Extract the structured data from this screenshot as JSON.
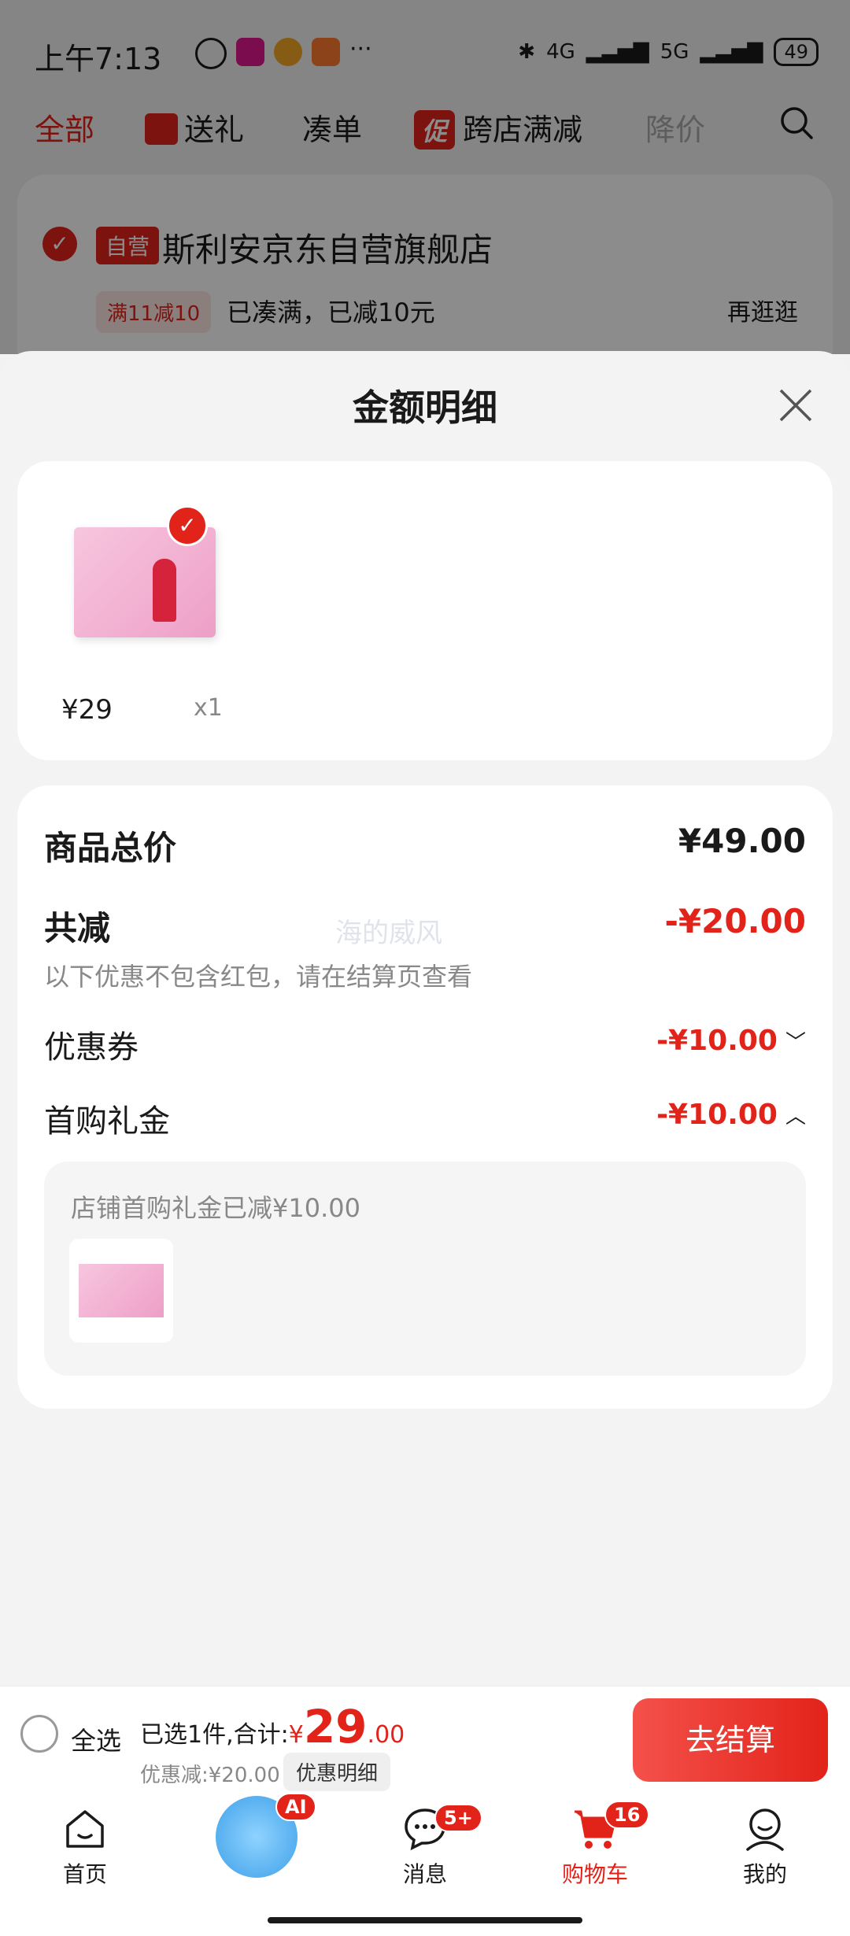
{
  "status_bar": {
    "time": "上午7:13",
    "network_left": "4G",
    "network_right": "5G",
    "battery": "49"
  },
  "top_tabs": {
    "all": "全部",
    "gift": "送礼",
    "combine": "凑单",
    "promo_badge": "促",
    "cross_store": "跨店满减",
    "price_drop": "降价"
  },
  "store": {
    "self_badge": "自营",
    "name": "斯利安京东自营旗舰店",
    "coupon_tag": "满11减10",
    "status": "已凑满，已减10元",
    "browse_more": "再逛逛"
  },
  "sheet": {
    "title": "金额明细",
    "product": {
      "price": "¥29",
      "quantity": "x1"
    },
    "summary": {
      "total_label": "商品总价",
      "total_value": "¥49.00",
      "discount_label": "共减",
      "discount_value": "-¥20.00",
      "discount_note": "以下优惠不包含红包，请在结算页查看",
      "watermark": "海的威风",
      "coupon_label": "优惠券",
      "coupon_value": "-¥10.00",
      "first_gift_label": "首购礼金",
      "first_gift_value": "-¥10.00",
      "first_gift_detail": "店铺首购礼金已减¥10.00"
    }
  },
  "bottom_bar": {
    "select_all": "全选",
    "selected_summary": "已选1件,合计:",
    "currency": "¥",
    "total_int": "29",
    "total_dec": ".00",
    "discount_text": "优惠减:¥20.00",
    "detail_button": "优惠明细",
    "checkout": "去结算"
  },
  "tab_bar": {
    "home": "首页",
    "ai_badge": "AI",
    "messages": "消息",
    "messages_badge": "5+",
    "cart": "购物车",
    "cart_badge": "16",
    "mine": "我的"
  },
  "colors": {
    "accent": "#e2231a",
    "background": "#f3f3f3"
  }
}
